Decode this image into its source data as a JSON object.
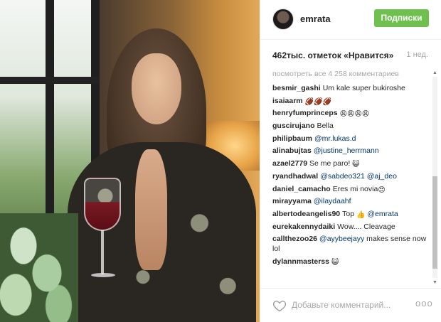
{
  "post": {
    "username": "emrata",
    "follow_label": "Подписки",
    "likes_text": "462тыс. отметок «Нравится»",
    "time_ago": "1 нед.",
    "view_all": "посмотреть все 4 258 комментариев",
    "comment_placeholder": "Добавьте комментарий...",
    "more_label": "ooo"
  },
  "comments": [
    {
      "user": "besmir_gashi",
      "text": "Um kale super bukiroshe",
      "emoji": ""
    },
    {
      "user": "isaiaarm",
      "text": "",
      "emoji": "🏈🏈🏈"
    },
    {
      "user": "henryfumprinceps",
      "text": "",
      "emoji": "😩😩😩😩"
    },
    {
      "user": "guscirujano",
      "text": "Bella",
      "emoji": ""
    },
    {
      "user": "philipbaum",
      "mention": "@mr.lukas.d",
      "text": "",
      "emoji": ""
    },
    {
      "user": "alinabujtas",
      "mention": "@justine_herrmann",
      "text": "",
      "emoji": ""
    },
    {
      "user": "azael2779",
      "text": "Se me paro!",
      "emoji": "😺"
    },
    {
      "user": "ryandhadwal",
      "mention": "@sabdeo321 @aj_deo",
      "text": "",
      "emoji": ""
    },
    {
      "user": "daniel_camacho",
      "text": "Eres mi novia",
      "emoji": "😍"
    },
    {
      "user": "mirayyama",
      "mention": "@ilaydaahf",
      "text": "",
      "emoji": ""
    },
    {
      "user": "albertodeangelis90",
      "text": "Top",
      "emoji": "👍",
      "mention_after": "@emrata"
    },
    {
      "user": "eurekakennydaiki",
      "text": "Wow.... Cleavage",
      "emoji": ""
    },
    {
      "user": "callthezoo26",
      "mention": "@ayybeejayy",
      "text": "makes sense now lol",
      "emoji": ""
    },
    {
      "user": "dylannmasterss",
      "text": "",
      "emoji": "😺"
    }
  ]
}
